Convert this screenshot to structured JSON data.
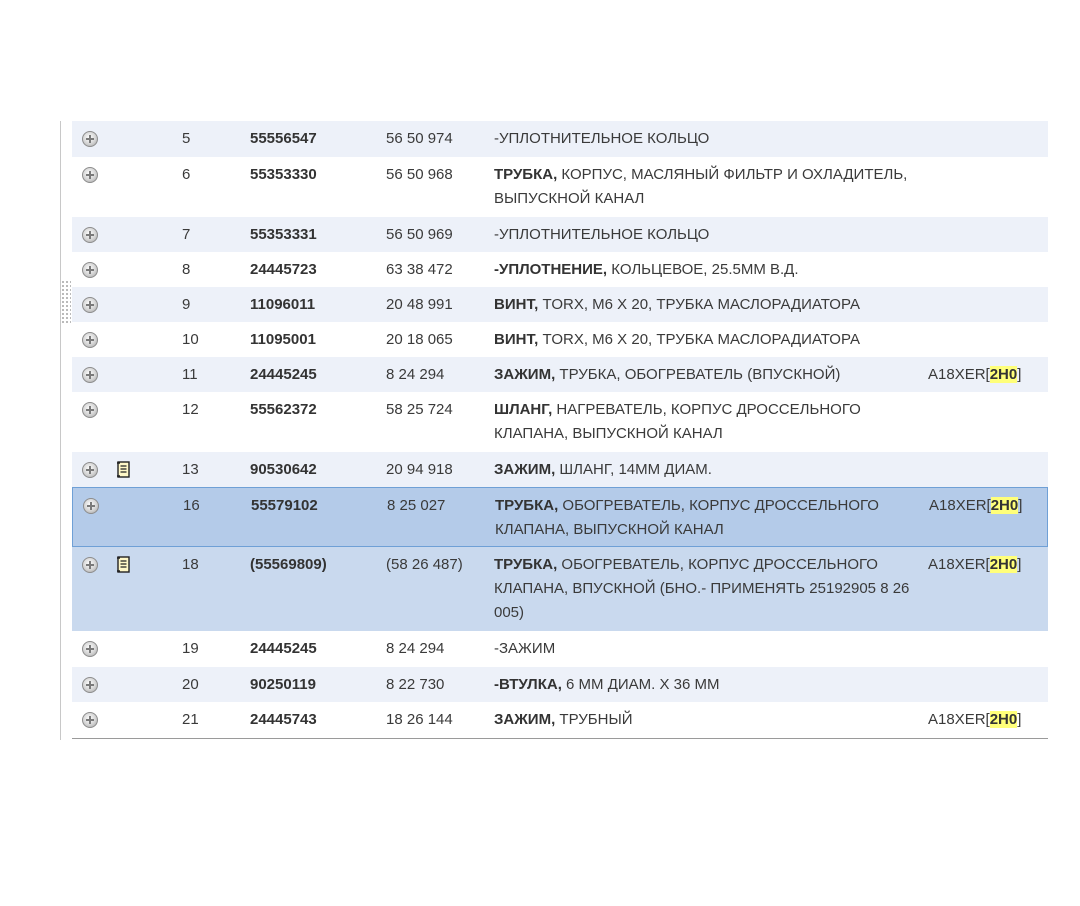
{
  "rows": [
    {
      "num": "5",
      "part": "55556547",
      "catalog": "56 50 974",
      "desc_bold": "",
      "desc_rest": "-УПЛОТНИТЕЛЬНОЕ КОЛЬЦО",
      "code": "",
      "code_hl": "",
      "note": false,
      "style": "alt"
    },
    {
      "num": "6",
      "part": "55353330",
      "catalog": "56 50 968",
      "desc_bold": "ТРУБКА,",
      "desc_rest": " КОРПУС, МАСЛЯНЫЙ ФИЛЬТР И ОХЛАДИТЕЛЬ, ВЫПУСКНОЙ КАНАЛ",
      "code": "",
      "code_hl": "",
      "note": false,
      "style": "plain"
    },
    {
      "num": "7",
      "part": "55353331",
      "catalog": "56 50 969",
      "desc_bold": "",
      "desc_rest": "-УПЛОТНИТЕЛЬНОЕ КОЛЬЦО",
      "code": "",
      "code_hl": "",
      "note": false,
      "style": "alt"
    },
    {
      "num": "8",
      "part": "24445723",
      "catalog": "63 38 472",
      "desc_bold": "-УПЛОТНЕНИЕ,",
      "desc_rest": " КОЛЬЦЕВОЕ, 25.5ММ В.Д.",
      "code": "",
      "code_hl": "",
      "note": false,
      "style": "plain"
    },
    {
      "num": "9",
      "part": "11096011",
      "catalog": "20 48 991",
      "desc_bold": "ВИНТ,",
      "desc_rest": " TORX, M6 X 20, ТРУБКА МАСЛОРАДИАТОРА",
      "code": "",
      "code_hl": "",
      "note": false,
      "style": "alt"
    },
    {
      "num": "10",
      "part": "11095001",
      "catalog": "20 18 065",
      "desc_bold": "ВИНТ,",
      "desc_rest": " TORX, M6 X 20, ТРУБКА МАСЛОРАДИАТОРА",
      "code": "",
      "code_hl": "",
      "note": false,
      "style": "plain"
    },
    {
      "num": "11",
      "part": "24445245",
      "catalog": "8 24 294",
      "desc_bold": "ЗАЖИМ,",
      "desc_rest": " ТРУБКА, ОБОГРЕВАТЕЛЬ (ВПУСКНОЙ)",
      "code": "A18XER[",
      "code_hl": "2H0",
      "code_end": "]",
      "note": false,
      "style": "alt"
    },
    {
      "num": "12",
      "part": "55562372",
      "catalog": "58 25 724",
      "desc_bold": "ШЛАНГ,",
      "desc_rest": " НАГРЕВАТЕЛЬ, КОРПУС ДРОССЕЛЬНОГО КЛАПАНА, ВЫПУСКНОЙ КАНАЛ",
      "code": "",
      "code_hl": "",
      "note": false,
      "style": "plain"
    },
    {
      "num": "13",
      "part": "90530642",
      "catalog": "20 94 918",
      "desc_bold": "ЗАЖИМ,",
      "desc_rest": " ШЛАНГ, 14ММ ДИАМ.",
      "code": "",
      "code_hl": "",
      "note": true,
      "style": "alt"
    },
    {
      "num": "16",
      "part": "55579102",
      "catalog": "8 25 027",
      "desc_bold": "ТРУБКА,",
      "desc_rest": " ОБОГРЕВАТЕЛЬ, КОРПУС ДРОССЕЛЬНОГО КЛАПАНА, ВЫПУСКНОЙ КАНАЛ",
      "code": "A18XER[",
      "code_hl": "2H0",
      "code_end": "]",
      "note": false,
      "style": "selected"
    },
    {
      "num": "18",
      "part": "(55569809)",
      "catalog": "(58 26 487)",
      "desc_bold": "ТРУБКА,",
      "desc_rest": " ОБОГРЕВАТЕЛЬ, КОРПУС ДРОССЕЛЬНОГО КЛАПАНА, ВПУСКНОЙ (БНО.- ПРИМЕНЯТЬ 25192905 8 26 005)",
      "code": "A18XER[",
      "code_hl": "2H0",
      "code_end": "]",
      "note": true,
      "style": "group"
    },
    {
      "num": "19",
      "part": "24445245",
      "catalog": "8 24 294",
      "desc_bold": "",
      "desc_rest": "-ЗАЖИМ",
      "code": "",
      "code_hl": "",
      "note": false,
      "style": "plain"
    },
    {
      "num": "20",
      "part": "90250119",
      "catalog": "8 22 730",
      "desc_bold": "-ВТУЛКА,",
      "desc_rest": " 6 ММ ДИАМ. X 36 ММ",
      "code": "",
      "code_hl": "",
      "note": false,
      "style": "alt"
    },
    {
      "num": "21",
      "part": "24445743",
      "catalog": "18 26 144",
      "desc_bold": "ЗАЖИМ,",
      "desc_rest": " ТРУБНЫЙ",
      "code": "A18XER[",
      "code_hl": "2H0",
      "code_end": "]",
      "note": false,
      "style": "plain"
    }
  ],
  "icons": {
    "expand": "expand-plus-icon",
    "note": "note-document-icon"
  },
  "colors": {
    "row_alt": "#edf1f9",
    "row_selected": "#b4cbe9",
    "row_group": "#c9d9ee",
    "highlight": "#ffff7a"
  }
}
